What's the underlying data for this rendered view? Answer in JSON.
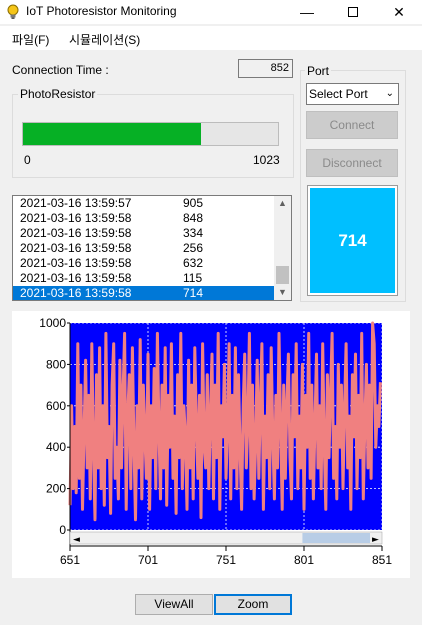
{
  "window": {
    "title": "IoT Photoresistor Monitoring"
  },
  "menu": [
    {
      "label": "파일(F)"
    },
    {
      "label": "시뮬레이션(S)"
    }
  ],
  "connection": {
    "label": "Connection Time :",
    "value": "852"
  },
  "photoresistor": {
    "group_title": "PhotoResistor",
    "min_label": "0",
    "max_label": "1023",
    "progress_fraction": 0.698
  },
  "port": {
    "group_title": "Port",
    "select_value": "Select Port",
    "connect_label": "Connect",
    "disconnect_label": "Disconnect"
  },
  "current_value": "714",
  "readings": [
    {
      "time": "2021-03-16 13:59:57",
      "value": "905"
    },
    {
      "time": "2021-03-16 13:59:58",
      "value": "848"
    },
    {
      "time": "2021-03-16 13:59:58",
      "value": "334"
    },
    {
      "time": "2021-03-16 13:59:58",
      "value": "256"
    },
    {
      "time": "2021-03-16 13:59:58",
      "value": "632"
    },
    {
      "time": "2021-03-16 13:59:58",
      "value": "115"
    },
    {
      "time": "2021-03-16 13:59:58",
      "value": "714",
      "selected": true
    }
  ],
  "colors": {
    "plot_background": "#0000ff",
    "series_line": "#f08080",
    "progress_fill": "#06b025",
    "value_panel": "#00bfff",
    "selection": "#0078d7"
  },
  "chart_data": {
    "type": "line",
    "title": "",
    "xlabel": "",
    "ylabel": "",
    "xlim": [
      651,
      851
    ],
    "ylim": [
      0,
      1000
    ],
    "xticks": [
      "651",
      "701",
      "751",
      "801",
      "851"
    ],
    "yticks": [
      "0",
      "200",
      "400",
      "600",
      "800",
      "1000"
    ],
    "grid": true,
    "legend": "none",
    "horizontal_scrollbar": true,
    "series": [
      {
        "x_start": 651,
        "x_step": 1,
        "values": [
          120,
          600,
          200,
          500,
          180,
          900,
          250,
          700,
          100,
          450,
          820,
          300,
          650,
          150,
          900,
          400,
          50,
          750,
          300,
          880,
          200,
          600,
          120,
          950,
          350,
          500,
          80,
          700,
          900,
          250,
          400,
          150,
          820,
          300,
          650,
          950,
          100,
          550,
          750,
          200,
          880,
          400,
          50,
          600,
          300,
          920,
          150,
          700,
          450,
          250,
          850,
          100,
          600,
          350,
          780,
          200,
          950,
          500,
          150,
          700,
          300,
          880,
          120,
          650,
          400,
          900,
          250,
          550,
          80,
          750,
          350,
          950,
          200,
          600,
          450,
          100,
          820,
          300,
          700,
          150,
          880,
          500,
          250,
          650,
          60,
          900,
          400,
          300,
          750,
          200,
          550,
          850,
          150,
          700,
          350,
          950,
          100,
          600,
          450,
          800,
          250,
          500,
          900,
          150,
          650,
          300,
          880,
          200,
          750,
          400,
          100,
          600,
          850,
          300,
          500,
          950,
          200,
          700,
          150,
          400,
          820,
          250,
          600,
          900,
          100,
          550,
          350,
          750,
          200,
          880,
          450,
          150,
          650,
          300,
          950,
          500,
          100,
          700,
          250,
          600,
          850,
          350,
          150,
          750,
          450,
          900,
          200,
          550,
          300,
          800,
          100,
          650,
          400,
          950,
          250,
          700,
          150,
          500,
          850,
          300,
          600,
          200,
          900,
          400,
          100,
          750,
          350,
          650,
          950,
          250,
          500,
          150,
          800,
          400,
          700,
          200,
          600,
          900,
          300,
          550,
          100,
          750,
          450,
          850,
          200,
          650,
          350,
          950,
          150,
          500,
          800,
          300,
          700,
          250,
          1000,
          900,
          400,
          600,
          500,
          714
        ]
      }
    ]
  }
}
